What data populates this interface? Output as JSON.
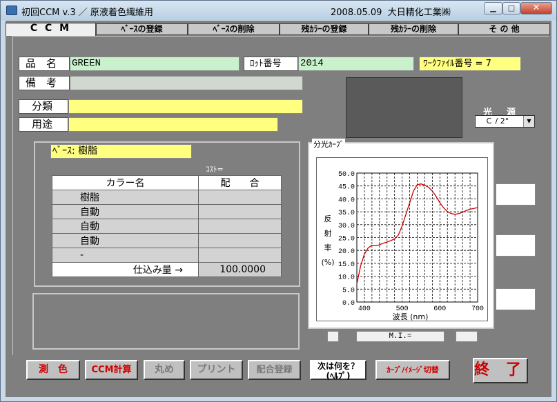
{
  "window": {
    "title": "初回CCM  v.3 ／ 原液着色繊維用",
    "date": "2008.05.09",
    "company": "大日精化工業㈱"
  },
  "tabs": [
    "C C M",
    "ﾍﾞｰｽの登録",
    "ﾍﾞｰｽの削除",
    "残ｶﾗｰの登録",
    "残ｶﾗｰの削除",
    "そ の 他"
  ],
  "form": {
    "product_label": "品　名",
    "product_value": "GREEN",
    "lot_label": "ﾛｯﾄ番号",
    "lot_value": "2014",
    "workfile_text": "ﾜｰｸﾌｧｲﾙ番号 = 7",
    "note_label": "備　考",
    "note_value": "",
    "category_label": "分類",
    "category_value": "",
    "use_label": "用途",
    "use_value": ""
  },
  "illuminant": {
    "label": "光　源",
    "value": "Ｃ / 2°"
  },
  "base": {
    "label": "ﾍﾞｰｽ: 樹脂",
    "cost_label": "ｺｽﾄ=",
    "col_name": "カラー名",
    "col_ratio": "配　　合",
    "rows": [
      "樹脂",
      "自動",
      "自動",
      "自動",
      "-"
    ],
    "total_label": "仕込み量 →",
    "total_value": "100.0000"
  },
  "curve": {
    "legend": "分光ｶｰﾌﾞ",
    "ylabel_chars": [
      "反",
      "射",
      "率",
      "(%)"
    ],
    "xlabel": "波長 (nm)"
  },
  "mi_label": "M.I.=",
  "buttons": {
    "measure": "測　色",
    "calc": "CCM計算",
    "round": "丸め",
    "print": "プリント",
    "register": "配合登録",
    "help_line1": "次は何を？",
    "help_line2": "(ﾍﾙﾌﾟ)",
    "toggle": "ｶｰﾌﾞ/ｲﾒｰｼﾞ切替",
    "end": "終 了"
  },
  "chart_data": {
    "type": "line",
    "title": "",
    "xlabel": "波長 (nm)",
    "ylabel": "反射率 (%)",
    "xlim": [
      380,
      700
    ],
    "ylim": [
      0,
      50
    ],
    "xticks": [
      400,
      500,
      600,
      700
    ],
    "yticks": [
      0.0,
      5.0,
      10.0,
      15.0,
      20.0,
      25.0,
      30.0,
      35.0,
      40.0,
      45.0,
      50.0
    ],
    "grid": true,
    "series": [
      {
        "x": [
          380,
          390,
          400,
          410,
          420,
          430,
          440,
          450,
          460,
          470,
          480,
          490,
          500,
          510,
          520,
          530,
          540,
          550,
          560,
          570,
          580,
          590,
          600,
          610,
          620,
          630,
          640,
          650,
          660,
          670,
          680,
          690,
          700
        ],
        "values": [
          7.0,
          14.0,
          18.5,
          21.0,
          22.0,
          21.8,
          22.2,
          22.8,
          23.3,
          23.8,
          24.5,
          26.0,
          29.5,
          34.0,
          38.5,
          43.0,
          45.5,
          45.8,
          45.3,
          44.5,
          43.0,
          41.0,
          38.5,
          36.5,
          35.0,
          34.3,
          34.0,
          34.3,
          34.8,
          35.5,
          36.0,
          36.3,
          36.6
        ],
        "color": "#cc0000"
      }
    ]
  }
}
